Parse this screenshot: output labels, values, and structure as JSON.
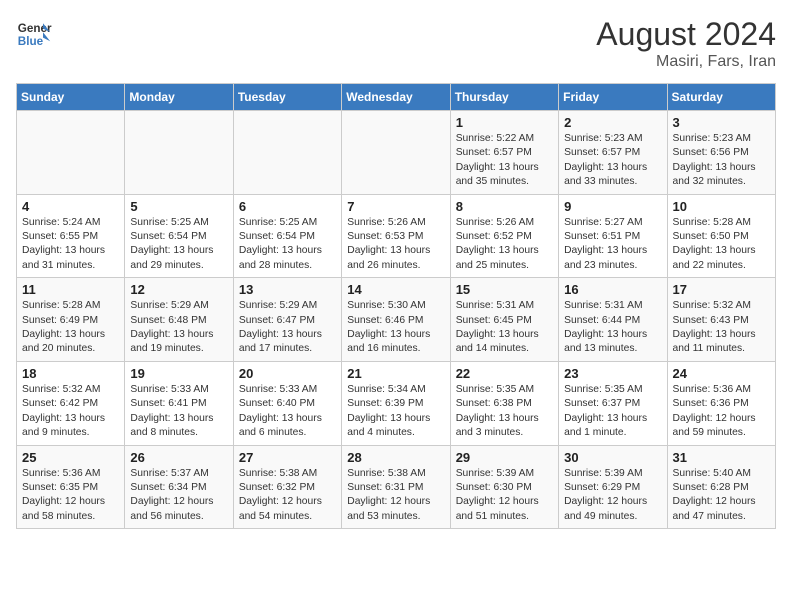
{
  "logo": {
    "line1": "General",
    "line2": "Blue"
  },
  "title": "August 2024",
  "subtitle": "Masiri, Fars, Iran",
  "days_of_week": [
    "Sunday",
    "Monday",
    "Tuesday",
    "Wednesday",
    "Thursday",
    "Friday",
    "Saturday"
  ],
  "weeks": [
    [
      {
        "day": "",
        "info": ""
      },
      {
        "day": "",
        "info": ""
      },
      {
        "day": "",
        "info": ""
      },
      {
        "day": "",
        "info": ""
      },
      {
        "day": "1",
        "info": "Sunrise: 5:22 AM\nSunset: 6:57 PM\nDaylight: 13 hours\nand 35 minutes."
      },
      {
        "day": "2",
        "info": "Sunrise: 5:23 AM\nSunset: 6:57 PM\nDaylight: 13 hours\nand 33 minutes."
      },
      {
        "day": "3",
        "info": "Sunrise: 5:23 AM\nSunset: 6:56 PM\nDaylight: 13 hours\nand 32 minutes."
      }
    ],
    [
      {
        "day": "4",
        "info": "Sunrise: 5:24 AM\nSunset: 6:55 PM\nDaylight: 13 hours\nand 31 minutes."
      },
      {
        "day": "5",
        "info": "Sunrise: 5:25 AM\nSunset: 6:54 PM\nDaylight: 13 hours\nand 29 minutes."
      },
      {
        "day": "6",
        "info": "Sunrise: 5:25 AM\nSunset: 6:54 PM\nDaylight: 13 hours\nand 28 minutes."
      },
      {
        "day": "7",
        "info": "Sunrise: 5:26 AM\nSunset: 6:53 PM\nDaylight: 13 hours\nand 26 minutes."
      },
      {
        "day": "8",
        "info": "Sunrise: 5:26 AM\nSunset: 6:52 PM\nDaylight: 13 hours\nand 25 minutes."
      },
      {
        "day": "9",
        "info": "Sunrise: 5:27 AM\nSunset: 6:51 PM\nDaylight: 13 hours\nand 23 minutes."
      },
      {
        "day": "10",
        "info": "Sunrise: 5:28 AM\nSunset: 6:50 PM\nDaylight: 13 hours\nand 22 minutes."
      }
    ],
    [
      {
        "day": "11",
        "info": "Sunrise: 5:28 AM\nSunset: 6:49 PM\nDaylight: 13 hours\nand 20 minutes."
      },
      {
        "day": "12",
        "info": "Sunrise: 5:29 AM\nSunset: 6:48 PM\nDaylight: 13 hours\nand 19 minutes."
      },
      {
        "day": "13",
        "info": "Sunrise: 5:29 AM\nSunset: 6:47 PM\nDaylight: 13 hours\nand 17 minutes."
      },
      {
        "day": "14",
        "info": "Sunrise: 5:30 AM\nSunset: 6:46 PM\nDaylight: 13 hours\nand 16 minutes."
      },
      {
        "day": "15",
        "info": "Sunrise: 5:31 AM\nSunset: 6:45 PM\nDaylight: 13 hours\nand 14 minutes."
      },
      {
        "day": "16",
        "info": "Sunrise: 5:31 AM\nSunset: 6:44 PM\nDaylight: 13 hours\nand 13 minutes."
      },
      {
        "day": "17",
        "info": "Sunrise: 5:32 AM\nSunset: 6:43 PM\nDaylight: 13 hours\nand 11 minutes."
      }
    ],
    [
      {
        "day": "18",
        "info": "Sunrise: 5:32 AM\nSunset: 6:42 PM\nDaylight: 13 hours\nand 9 minutes."
      },
      {
        "day": "19",
        "info": "Sunrise: 5:33 AM\nSunset: 6:41 PM\nDaylight: 13 hours\nand 8 minutes."
      },
      {
        "day": "20",
        "info": "Sunrise: 5:33 AM\nSunset: 6:40 PM\nDaylight: 13 hours\nand 6 minutes."
      },
      {
        "day": "21",
        "info": "Sunrise: 5:34 AM\nSunset: 6:39 PM\nDaylight: 13 hours\nand 4 minutes."
      },
      {
        "day": "22",
        "info": "Sunrise: 5:35 AM\nSunset: 6:38 PM\nDaylight: 13 hours\nand 3 minutes."
      },
      {
        "day": "23",
        "info": "Sunrise: 5:35 AM\nSunset: 6:37 PM\nDaylight: 13 hours\nand 1 minute."
      },
      {
        "day": "24",
        "info": "Sunrise: 5:36 AM\nSunset: 6:36 PM\nDaylight: 12 hours\nand 59 minutes."
      }
    ],
    [
      {
        "day": "25",
        "info": "Sunrise: 5:36 AM\nSunset: 6:35 PM\nDaylight: 12 hours\nand 58 minutes."
      },
      {
        "day": "26",
        "info": "Sunrise: 5:37 AM\nSunset: 6:34 PM\nDaylight: 12 hours\nand 56 minutes."
      },
      {
        "day": "27",
        "info": "Sunrise: 5:38 AM\nSunset: 6:32 PM\nDaylight: 12 hours\nand 54 minutes."
      },
      {
        "day": "28",
        "info": "Sunrise: 5:38 AM\nSunset: 6:31 PM\nDaylight: 12 hours\nand 53 minutes."
      },
      {
        "day": "29",
        "info": "Sunrise: 5:39 AM\nSunset: 6:30 PM\nDaylight: 12 hours\nand 51 minutes."
      },
      {
        "day": "30",
        "info": "Sunrise: 5:39 AM\nSunset: 6:29 PM\nDaylight: 12 hours\nand 49 minutes."
      },
      {
        "day": "31",
        "info": "Sunrise: 5:40 AM\nSunset: 6:28 PM\nDaylight: 12 hours\nand 47 minutes."
      }
    ]
  ]
}
